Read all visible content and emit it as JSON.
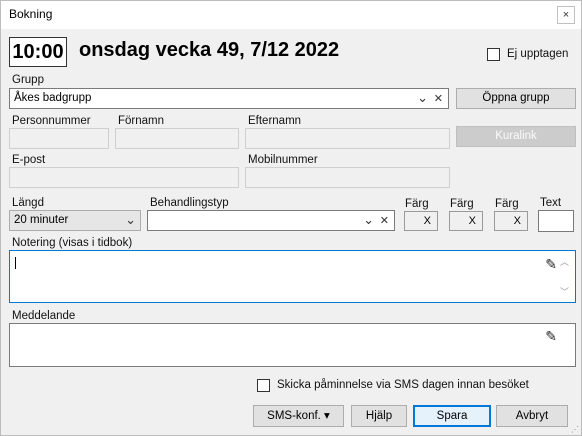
{
  "window": {
    "title": "Bokning",
    "close_glyph": "×"
  },
  "header": {
    "time": "10:00",
    "date_text": "onsdag vecka 49, 7/12 2022",
    "not_busy_label": "Ej upptagen",
    "not_busy_checked": false
  },
  "group": {
    "label": "Grupp",
    "value": "Åkes badgrupp",
    "open_button": "Öppna grupp",
    "dropdown_glyph": "⌄",
    "clear_glyph": "✕"
  },
  "person": {
    "ssn_label": "Personnummer",
    "firstname_label": "Förnamn",
    "lastname_label": "Efternamn",
    "kuralink_button": "Kuralink",
    "email_label": "E-post",
    "mobile_label": "Mobilnummer",
    "ssn_value": "",
    "firstname_value": "",
    "lastname_value": "",
    "email_value": "",
    "mobile_value": ""
  },
  "booking": {
    "length_label": "Längd",
    "length_value": "20 minuter",
    "treatment_label": "Behandlingstyp",
    "treatment_value": "",
    "color_label_1": "Färg",
    "color_label_2": "Färg",
    "color_label_3": "Färg",
    "text_label": "Text",
    "color_clear_glyph": "X"
  },
  "notes": {
    "note_label": "Notering (visas i tidbok)",
    "note_value": "",
    "message_label": "Meddelande",
    "message_value": "",
    "pencil_glyph": "✎"
  },
  "sms": {
    "reminder_label": "Skicka påminnelse via SMS dagen innan besöket",
    "reminder_checked": false
  },
  "footer": {
    "sms_conf_button": "SMS-konf. ▾",
    "help_button": "Hjälp",
    "save_button": "Spara",
    "cancel_button": "Avbryt"
  }
}
